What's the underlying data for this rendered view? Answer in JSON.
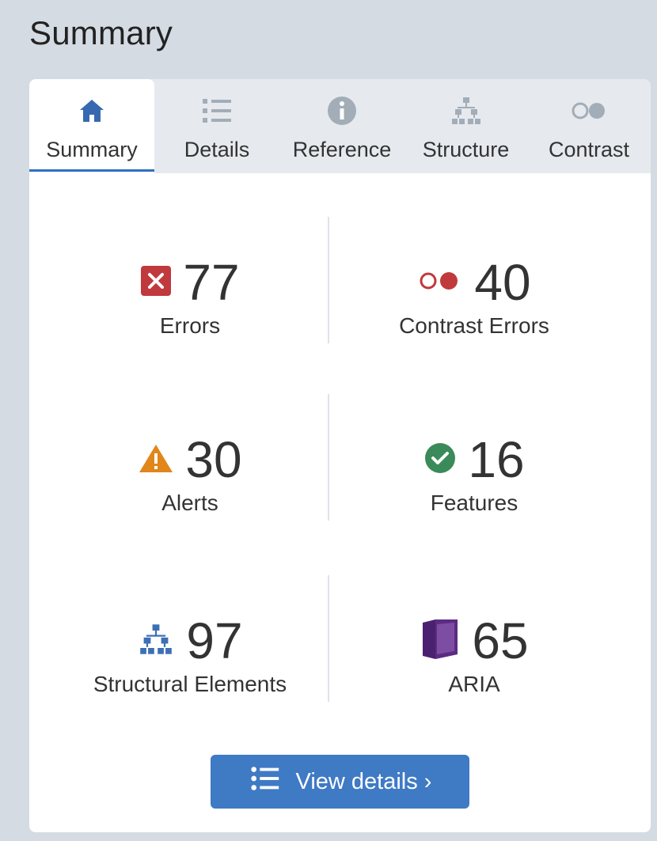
{
  "header": {
    "title": "Summary"
  },
  "tabs": [
    {
      "label": "Summary",
      "icon": "home-icon"
    },
    {
      "label": "Details",
      "icon": "list-icon"
    },
    {
      "label": "Reference",
      "icon": "info-icon"
    },
    {
      "label": "Structure",
      "icon": "hierarchy-icon"
    },
    {
      "label": "Contrast",
      "icon": "contrast-icon"
    }
  ],
  "stats": {
    "errors": {
      "value": "77",
      "label": "Errors",
      "icon": "error-x-icon",
      "color": "#c0393d"
    },
    "contrast_errors": {
      "value": "40",
      "label": "Contrast Errors",
      "icon": "contrast-circles-icon",
      "color": "#c0393d"
    },
    "alerts": {
      "value": "30",
      "label": "Alerts",
      "icon": "warning-icon",
      "color": "#e0861a"
    },
    "features": {
      "value": "16",
      "label": "Features",
      "icon": "checkmark-circle-icon",
      "color": "#3a8a5a"
    },
    "structural": {
      "value": "97",
      "label": "Structural Elements",
      "icon": "structure-icon",
      "color": "#3d6fb5"
    },
    "aria": {
      "value": "65",
      "label": "ARIA",
      "icon": "aria-box-icon",
      "color": "#5b2c82"
    }
  },
  "button": {
    "label": "View details ›",
    "icon": "list-icon"
  },
  "colors": {
    "accent": "#3f7ac4",
    "tab_active_underline": "#2f6fbf"
  }
}
